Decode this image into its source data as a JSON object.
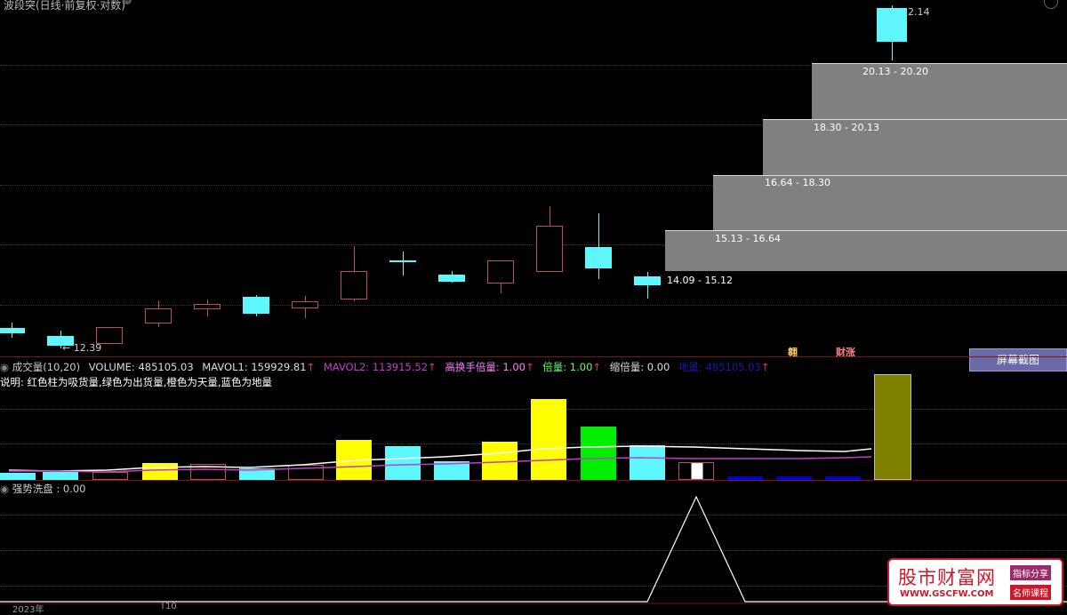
{
  "top_title": "波段突(日线·前复权·对数)",
  "price_labels": {
    "low": "12.39",
    "high_right": "2.14",
    "last_range": "14.09 - 15.12"
  },
  "volume_profile": [
    {
      "range": "20.13 - 20.20",
      "level": 1.0
    },
    {
      "range": "18.30 - 20.13",
      "level": 0.76
    },
    {
      "range": "16.64 - 18.30",
      "level": 0.6
    },
    {
      "range": "15.13 - 16.64",
      "level": 0.46
    }
  ],
  "tags": {
    "tag1": "翱",
    "tag2": "财涨"
  },
  "screenshot_button": "屏幕截图",
  "volume_header": {
    "name": "成交量(10,20)",
    "volume": "VOLUME: 485105.03",
    "mavol1": "MAVOL1: 159929.81",
    "mavol2": "MAVOL2: 113915.52",
    "gaohuan": "高换手倍量: 1.00",
    "beiliang": "倍量: 1.00",
    "suobei": "缩倍量: 0.00",
    "diliang": "地量: 485105.03",
    "up_arrow": "↑"
  },
  "volume_note": "说明: 红色柱为吸货量,绿色为出货量,橙色为天量,蓝色为地量",
  "indicator_header": "强势洗盘 : 0.00",
  "bottom_axis": {
    "year": "2023年",
    "tick": "10"
  },
  "watermark": {
    "title": "股市财富网",
    "url": "WWW.GSCFW.COM",
    "tag1": "指标分享",
    "tag2": "名师课程"
  },
  "colors": {
    "up": "#c0504d",
    "down": "#5ff7ff",
    "yellow": "#ffff00",
    "green": "#00ee00",
    "olive": "#808000",
    "blue": "#0000cc",
    "ma1": "#ffffff",
    "ma2": "#c040c0"
  }
}
